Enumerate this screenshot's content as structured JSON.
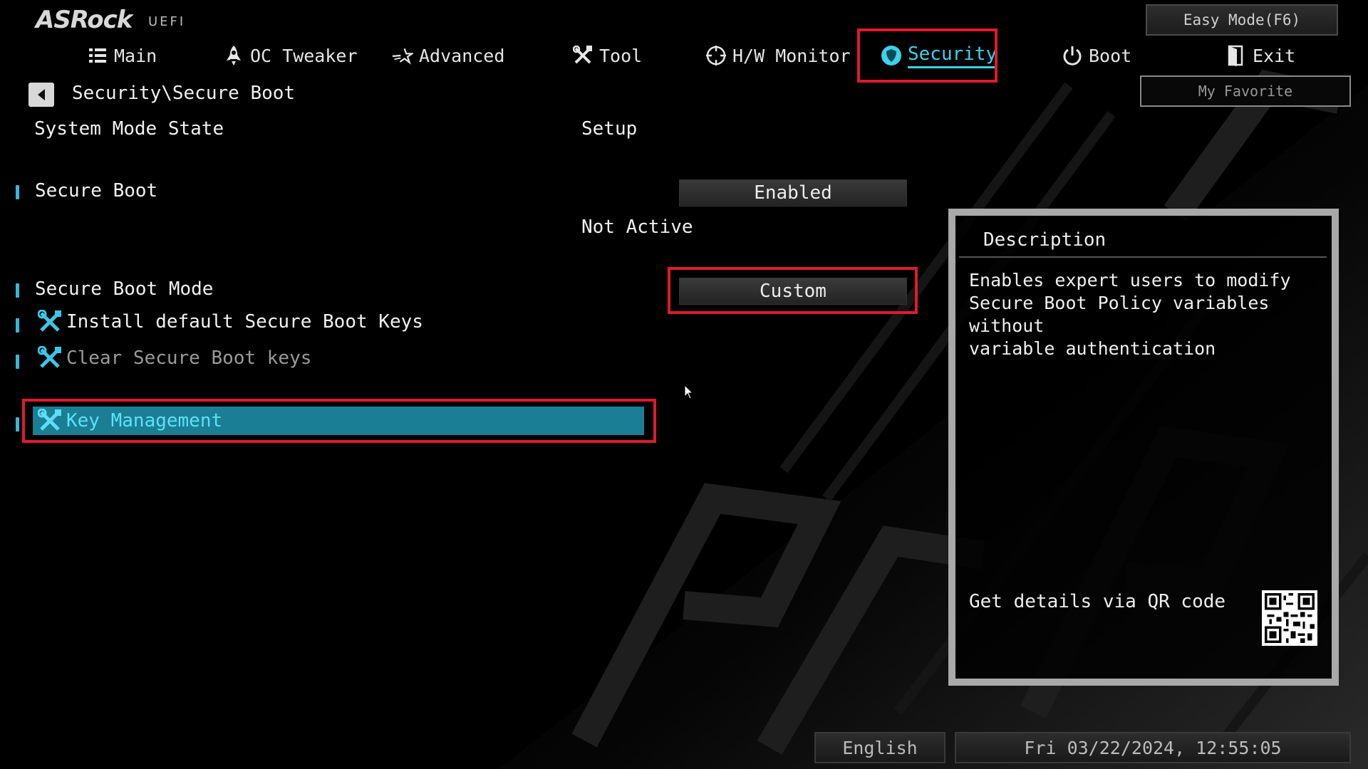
{
  "header": {
    "brand": "ASRock",
    "brand_suffix": "UEFI",
    "easy_mode_label": "Easy Mode(F6)",
    "my_favorite_label": "My Favorite"
  },
  "tabs": [
    {
      "label": "Main",
      "icon": "list-icon"
    },
    {
      "label": "OC Tweaker",
      "icon": "rocket-icon"
    },
    {
      "label": "Advanced",
      "icon": "star-icon"
    },
    {
      "label": "Tool",
      "icon": "tools-icon"
    },
    {
      "label": "H/W Monitor",
      "icon": "crosshair-icon"
    },
    {
      "label": "Security",
      "icon": "shield-icon",
      "active": true
    },
    {
      "label": "Boot",
      "icon": "power-icon"
    },
    {
      "label": "Exit",
      "icon": "exit-icon"
    }
  ],
  "breadcrumb": "Security\\Secure Boot",
  "settings": {
    "system_mode_label": "System Mode State",
    "system_mode_value": "Setup",
    "secure_boot_label": "Secure Boot",
    "secure_boot_value": "Enabled",
    "secure_boot_status": "Not Active",
    "secure_boot_mode_label": "Secure Boot Mode",
    "secure_boot_mode_value": "Custom",
    "install_keys_label": "Install default Secure Boot Keys",
    "clear_keys_label": "Clear Secure Boot keys",
    "key_management_label": "Key Management"
  },
  "description": {
    "title": "Description",
    "text": "Enables expert users to modify\nSecure Boot Policy variables without\nvariable authentication",
    "qr_label": "Get details via QR code"
  },
  "footer": {
    "language": "English",
    "datetime": "Fri 03/22/2024, 12:55:05"
  },
  "colors": {
    "accent": "#3fd0ea",
    "highlight": "#1a7e94",
    "annotation": "#e01a2c"
  }
}
